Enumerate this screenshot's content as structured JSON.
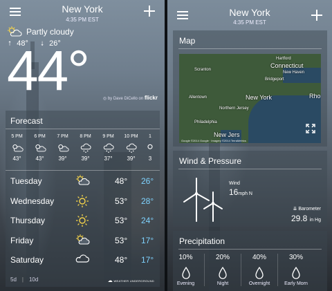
{
  "left": {
    "city": "New York",
    "time": "4:35 PM EST",
    "condition": "Partly cloudy",
    "high": "48°",
    "low": "26°",
    "current_temp": "44°",
    "photo_credit": "by Dave DiCello on",
    "photo_credit_brand": "flickr",
    "forecast_title": "Forecast",
    "hourly": [
      {
        "time": "5 PM",
        "temp": "43°",
        "icon": "partly-cloudy-icon"
      },
      {
        "time": "6 PM",
        "temp": "43°",
        "icon": "partly-cloudy-icon"
      },
      {
        "time": "7 PM",
        "temp": "39°",
        "icon": "partly-cloudy-icon"
      },
      {
        "time": "8 PM",
        "temp": "39°",
        "icon": "snow-cloud-icon"
      },
      {
        "time": "9 PM",
        "temp": "37°",
        "icon": "snow-cloud-icon"
      },
      {
        "time": "10 PM",
        "temp": "39°",
        "icon": "snow-cloud-icon"
      },
      {
        "time": "1",
        "temp": "3",
        "icon": "partly-cloudy-icon"
      }
    ],
    "daily": [
      {
        "day": "Tuesday",
        "hi": "48°",
        "lo": "26°",
        "icon": "partly-cloudy-icon"
      },
      {
        "day": "Wednesday",
        "hi": "53°",
        "lo": "28°",
        "icon": "sun-icon"
      },
      {
        "day": "Thursday",
        "hi": "53°",
        "lo": "24°",
        "icon": "sun-icon"
      },
      {
        "day": "Friday",
        "hi": "53°",
        "lo": "17°",
        "icon": "partly-cloudy-icon"
      },
      {
        "day": "Saturday",
        "hi": "48°",
        "lo": "17°",
        "icon": "cloud-icon"
      }
    ],
    "tab_5d": "5d",
    "tab_10d": "10d",
    "provider": "WEATHER UNDERGROUND"
  },
  "right": {
    "city": "New York",
    "time": "4:35 PM EST",
    "map_title": "Map",
    "map_labels": {
      "hartford": "Hartford",
      "connecticut": "Connecticut",
      "newhaven": "New Haven",
      "bridgeport": "Bridgeport",
      "scranton": "Scranton",
      "allentown": "Allentown",
      "newyork": "New York",
      "northernjersey": "Northern Jersey",
      "philadelphia": "Philadelphia",
      "newjersey": "New Jers",
      "rho": "Rho"
    },
    "map_attribution": "Google  ©2014 Google · Imagery ©2014 TerraMetrics",
    "wind_title": "Wind & Pressure",
    "wind_label": "Wind",
    "wind_speed": "16",
    "wind_unit": "mph  N",
    "baro_label": "Barometer",
    "baro_value": "29.8",
    "baro_unit": "in Hg",
    "precip_title": "Precipitation",
    "precip": [
      {
        "pct": "10%",
        "label": "Evening"
      },
      {
        "pct": "20%",
        "label": "Night"
      },
      {
        "pct": "40%",
        "label": "Overnight"
      },
      {
        "pct": "30%",
        "label": "Early Morn"
      }
    ]
  },
  "colors": {
    "accent_low": "#7fd3ff",
    "panel": "rgba(60,70,80,0.45)"
  }
}
